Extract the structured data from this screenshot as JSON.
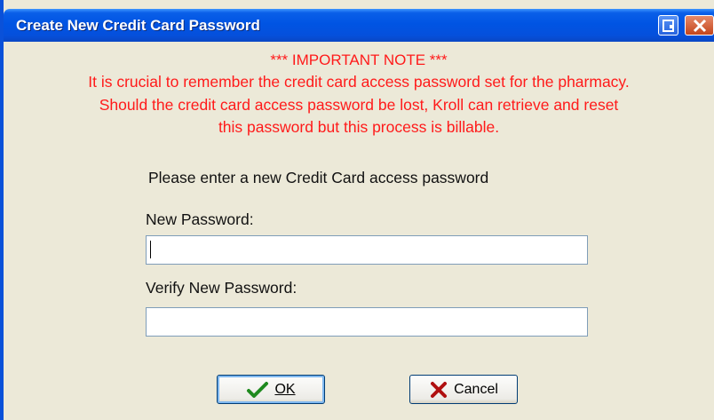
{
  "window": {
    "title": "Create New Credit Card Password"
  },
  "note": {
    "heading": "*** IMPORTANT NOTE ***",
    "line1": "It is crucial to remember the credit card access password set for the pharmacy.",
    "line2": "Should the credit card access password be lost, Kroll can retrieve and reset",
    "line3": "this password but this process is billable."
  },
  "form": {
    "prompt": "Please enter a new Credit Card access password",
    "new_password_label": "New Password:",
    "new_password_value": "",
    "verify_password_label": "Verify New Password:",
    "verify_password_value": ""
  },
  "buttons": {
    "ok_label": "OK",
    "cancel_label": "Cancel"
  },
  "colors": {
    "note_text": "#ff1a1a",
    "titlebar": "#0054e3",
    "dialog_bg": "#ece9d8"
  }
}
